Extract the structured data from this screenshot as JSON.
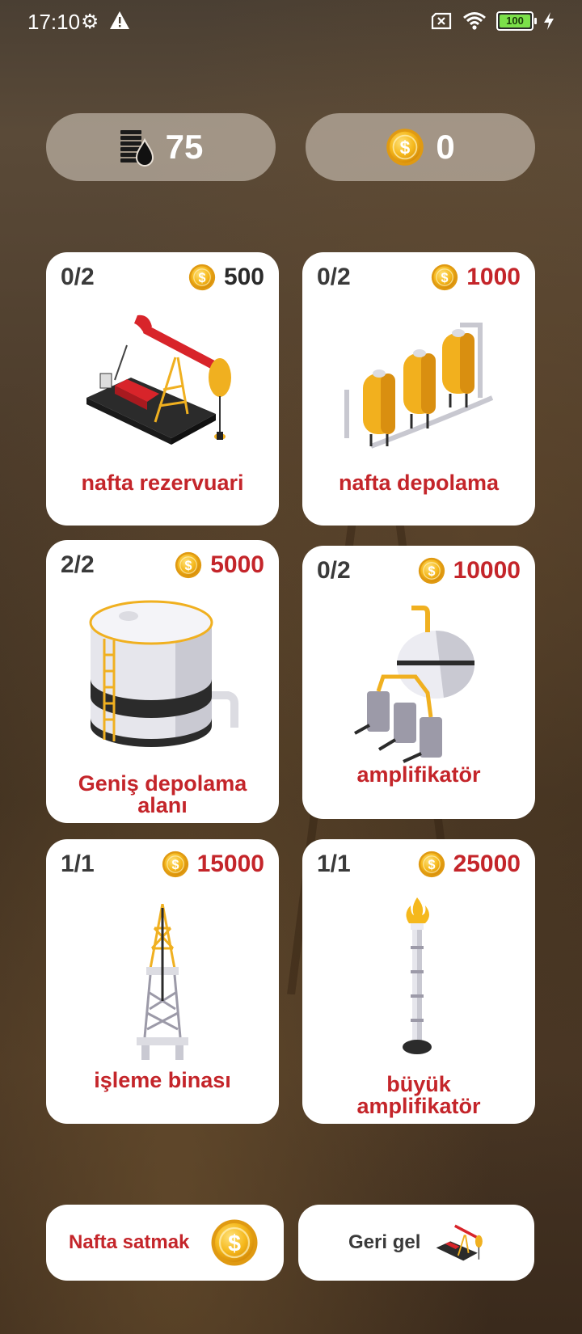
{
  "status_bar": {
    "time": "17:10",
    "battery": "100"
  },
  "resources": {
    "oil": "75",
    "coins": "0"
  },
  "cards": [
    {
      "count": "0/2",
      "price": "500",
      "title": "nafta rezervuari",
      "price_color": "#2a2a2a"
    },
    {
      "count": "0/2",
      "price": "1000",
      "title": "nafta depolama",
      "price_color": "#c4252a"
    },
    {
      "count": "2/2",
      "price": "5000",
      "title": "Geniş depolama alanı",
      "title_line1": "Geniş depolama",
      "title_line2": "alanı",
      "price_color": "#c4252a"
    },
    {
      "count": "0/2",
      "price": "10000",
      "title": "amplifikatör",
      "price_color": "#c4252a"
    },
    {
      "count": "1/1",
      "price": "15000",
      "title": "işleme binası",
      "price_color": "#c4252a"
    },
    {
      "count": "1/1",
      "price": "25000",
      "title": "büyük amplifikatör",
      "title_line1": "büyük",
      "title_line2": "amplifikatör",
      "price_color": "#c4252a"
    }
  ],
  "buttons": {
    "sell": "Nafta satmak",
    "back": "Geri gel"
  },
  "colors": {
    "accent_red": "#c4252a",
    "coin_gold": "#f5b81c"
  }
}
